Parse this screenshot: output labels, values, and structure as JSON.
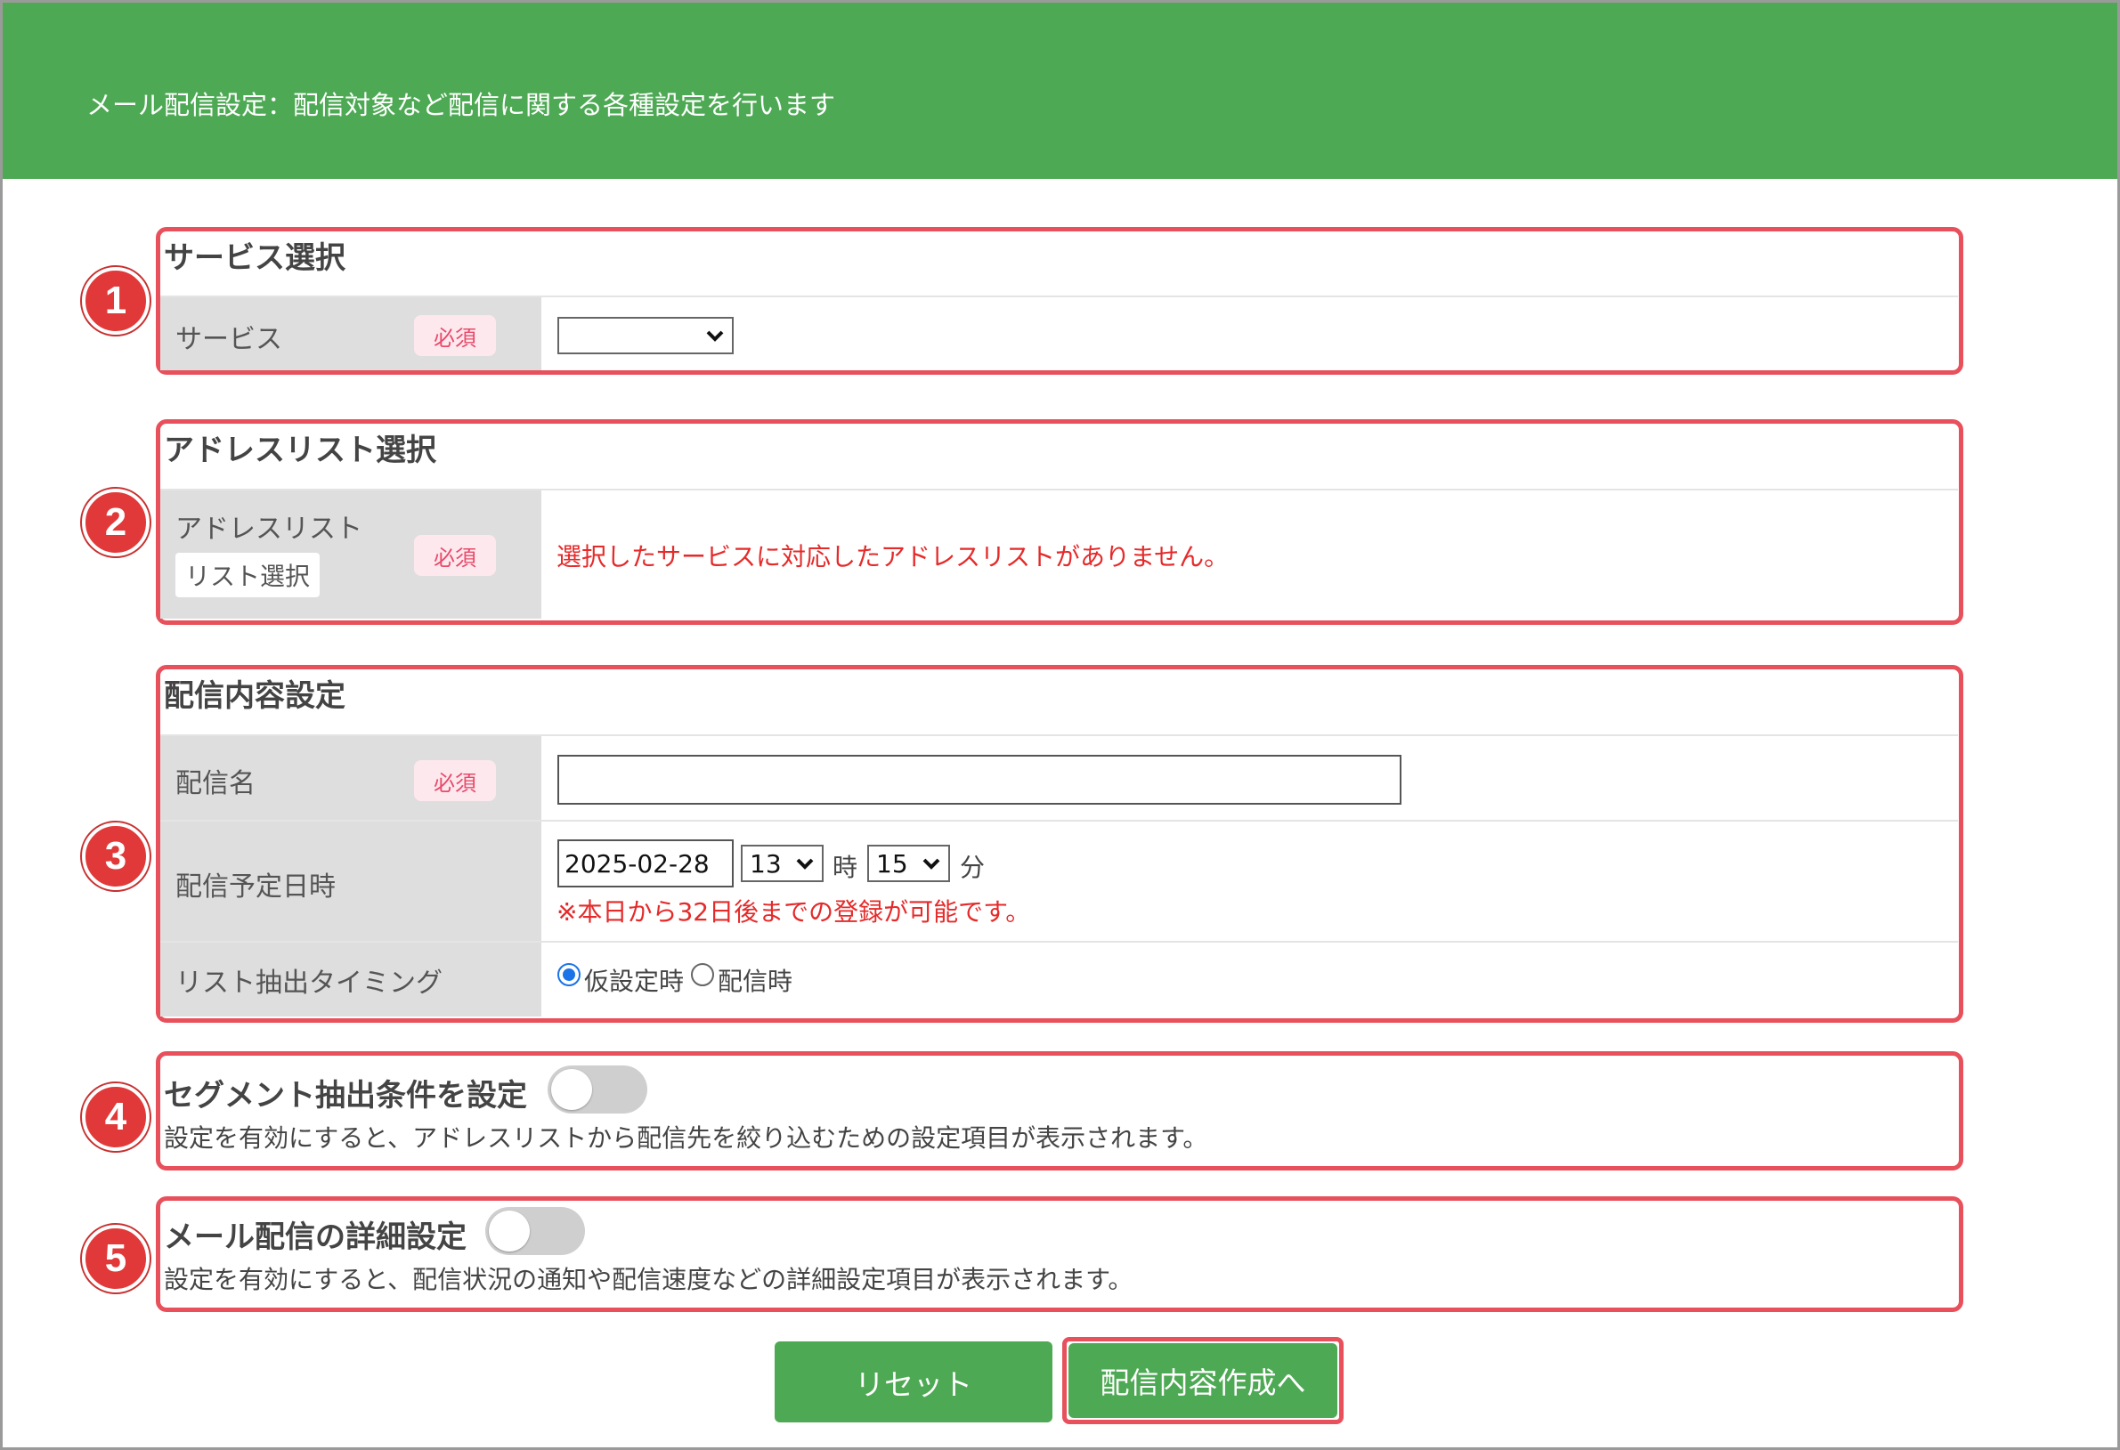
{
  "header": {
    "title": "メール配信設定：配信対象など配信に関する各種設定を行います"
  },
  "markers": [
    "1",
    "2",
    "3",
    "4",
    "5"
  ],
  "service_section": {
    "title": "サービス選択",
    "label": "サービス",
    "required": "必須",
    "select_value": ""
  },
  "address_section": {
    "title": "アドレスリスト選択",
    "label": "アドレスリスト",
    "list_button": "リスト選択",
    "required": "必須",
    "message": "選択したサービスに対応したアドレスリストがありません。"
  },
  "content_section": {
    "title": "配信内容設定",
    "name_label": "配信名",
    "name_required": "必須",
    "name_value": "",
    "date_label": "配信予定日時",
    "date_value": "2025-02-28",
    "hour_value": "13",
    "hour_unit": "時",
    "minute_value": "15",
    "minute_unit": "分",
    "date_note": "※本日から32日後までの登録が可能です。",
    "timing_label": "リスト抽出タイミング",
    "timing_options": [
      "仮設定時",
      "配信時"
    ],
    "timing_selected": "仮設定時"
  },
  "segment_section": {
    "title": "セグメント抽出条件を設定",
    "enabled": false,
    "description": "設定を有効にすると、アドレスリストから配信先を絞り込むための設定項目が表示されます。"
  },
  "detail_section": {
    "title": "メール配信の詳細設定",
    "enabled": false,
    "description": "設定を有効にすると、配信状況の通知や配信速度などの詳細設定項目が表示されます。"
  },
  "buttons": {
    "reset": "リセット",
    "next": "配信内容作成へ"
  },
  "colors": {
    "header": "#4ea954",
    "highlight": "#e8505b",
    "error": "#e52a2a",
    "badge": "#e84a6a"
  }
}
